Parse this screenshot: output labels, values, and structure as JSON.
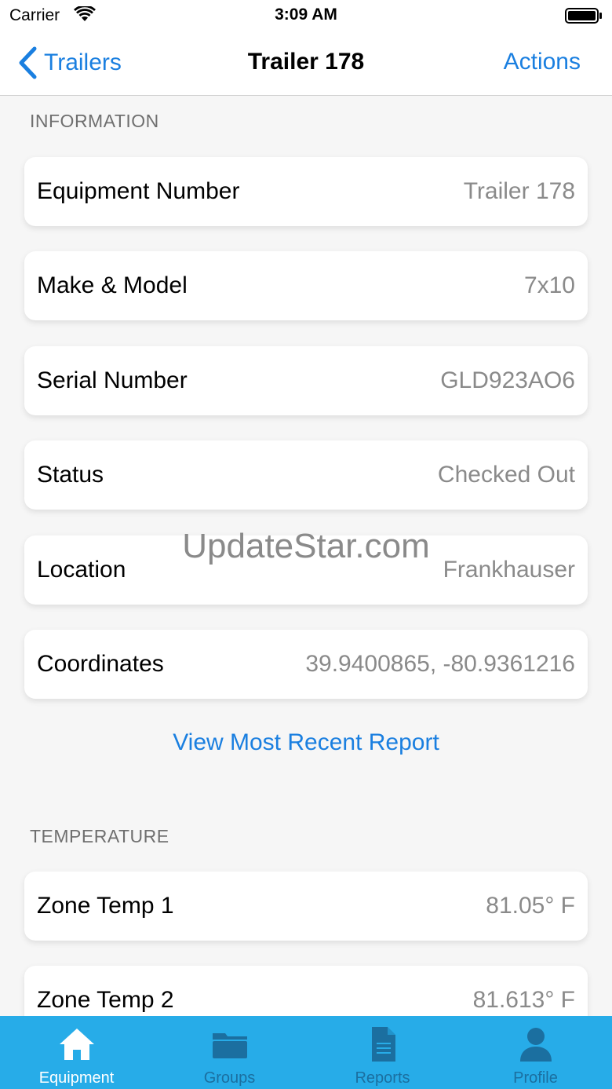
{
  "status_bar": {
    "carrier": "Carrier",
    "time": "3:09 AM"
  },
  "nav": {
    "back_label": "Trailers",
    "title": "Trailer 178",
    "actions_label": "Actions"
  },
  "information": {
    "header": "INFORMATION",
    "rows": [
      {
        "label": "Equipment Number",
        "value": "Trailer 178"
      },
      {
        "label": "Make & Model",
        "value": "7x10"
      },
      {
        "label": "Serial Number",
        "value": "GLD923AO6"
      },
      {
        "label": "Status",
        "value": "Checked Out"
      },
      {
        "label": "Location",
        "value": "Frankhauser"
      },
      {
        "label": "Coordinates",
        "value": "39.9400865, -80.9361216"
      }
    ],
    "link_label": "View Most Recent Report"
  },
  "temperature": {
    "header": "TEMPERATURE",
    "rows": [
      {
        "label": "Zone Temp 1",
        "value": "81.05° F"
      },
      {
        "label": "Zone Temp 2",
        "value": "81.613° F"
      }
    ]
  },
  "watermark": "UpdateStar.com",
  "tabs": [
    {
      "label": "Equipment",
      "icon": "house-icon",
      "active": true
    },
    {
      "label": "Groups",
      "icon": "folder-icon",
      "active": false
    },
    {
      "label": "Reports",
      "icon": "document-icon",
      "active": false
    },
    {
      "label": "Profile",
      "icon": "person-icon",
      "active": false
    }
  ],
  "colors": {
    "accent": "#1a7fe0",
    "tab_bar": "#27ace8",
    "tab_inactive": "#1b6fa0",
    "background": "#f6f6f6"
  }
}
